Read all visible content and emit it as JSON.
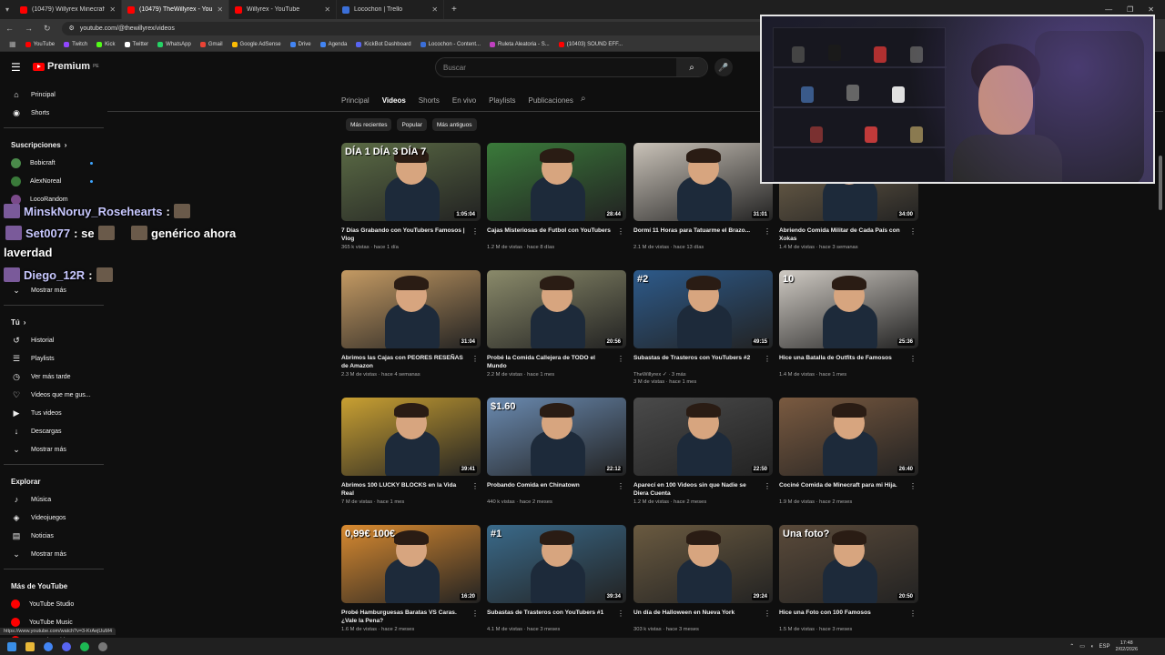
{
  "browser": {
    "tabs": [
      {
        "title": "(10479) Willyrex Minecraft - Yo",
        "active": false,
        "type": "youtube"
      },
      {
        "title": "(10479) TheWillyrex - YouTube",
        "active": true,
        "type": "youtube"
      },
      {
        "title": "Willyrex - YouTube",
        "active": false,
        "type": "youtube"
      },
      {
        "title": "Locochon | Trello",
        "active": false,
        "type": "trello"
      }
    ],
    "url": "youtube.com/@thewillyrex/videos",
    "bookmarks": [
      "YouTube",
      "Twitch",
      "Kick",
      "Twitter",
      "WhatsApp",
      "Gmail",
      "Google AdSense",
      "Drive",
      "Agenda",
      "KickBot Dashboard",
      "Locochon - Content...",
      "Ruleta Aleatoria - S...",
      "(10403) SOUND EFF..."
    ]
  },
  "youtube": {
    "logo_text": "Premium",
    "logo_sup": "PE",
    "search_placeholder": "Buscar"
  },
  "sidebar": {
    "main": [
      {
        "label": "Principal",
        "icon": "home-icon"
      },
      {
        "label": "Shorts",
        "icon": "shorts-icon"
      }
    ],
    "subs_header": "Suscripciones",
    "subs": [
      {
        "label": "Bobicraft",
        "live": true
      },
      {
        "label": "AlexNoreal",
        "live": true
      },
      {
        "label": "LocoRandom",
        "live": false
      }
    ],
    "show_more_1": "Mostrar más",
    "you_header": "Tú",
    "you_items": [
      {
        "label": "Historial",
        "icon": "history-icon"
      },
      {
        "label": "Playlists",
        "icon": "playlist-icon"
      },
      {
        "label": "Ver más tarde",
        "icon": "clock-icon"
      },
      {
        "label": "Videos que me gus...",
        "icon": "like-icon"
      },
      {
        "label": "Tus videos",
        "icon": "video-icon"
      },
      {
        "label": "Descargas",
        "icon": "download-icon"
      }
    ],
    "show_more_2": "Mostrar más",
    "explore_header": "Explorar",
    "explore_items": [
      {
        "label": "Música",
        "icon": "music-icon"
      },
      {
        "label": "Videojuegos",
        "icon": "gamepad-icon"
      },
      {
        "label": "Noticias",
        "icon": "news-icon"
      }
    ],
    "show_more_3": "Mostrar más",
    "more_header": "Más de YouTube",
    "more_items": [
      {
        "label": "YouTube Studio"
      },
      {
        "label": "YouTube Music"
      },
      {
        "label": "YouTube Kids"
      }
    ]
  },
  "chat_overlay": [
    {
      "user": "MinskNoruy_Rosehearts",
      "msg": ":"
    },
    {
      "user": "Set0077",
      "msg": ": se"
    },
    {
      "user": "",
      "msg": "genérico ahora"
    },
    {
      "user": "",
      "msg": "laverdad"
    },
    {
      "user": "Diego_12R",
      "msg": ":"
    }
  ],
  "channel_tabs": [
    "Principal",
    "Videos",
    "Shorts",
    "En vivo",
    "Playlists",
    "Publicaciones"
  ],
  "active_tab": "Videos",
  "chips": [
    "Más recientes",
    "Popular",
    "Más antiguos"
  ],
  "videos": [
    {
      "title": "7 Días Grabando con YouTubers Famosos | Vlog",
      "meta": "365 k vistas · hace 1 día",
      "duration": "1:05:04",
      "overlay": "DÍA 1   DÍA 3   DÍA 7",
      "bg": "#5b6b45"
    },
    {
      "title": "Cajas Misteriosas de Futbol con YouTubers",
      "meta": "1.2 M de vistas · hace 8 días",
      "duration": "28:44",
      "overlay": "",
      "bg": "#3a7a3a"
    },
    {
      "title": "Dormí 11 Horas para Tatuarme el Brazo...",
      "meta": "2.1 M de vistas · hace 13 días",
      "duration": "31:01",
      "overlay": "",
      "bg": "#c9c2b8"
    },
    {
      "title": "Abriendo Comida Militar de Cada País con Xokas",
      "meta": "1.4 M de vistas · hace 3 semanas",
      "duration": "34:00",
      "overlay": "",
      "bg": "#7a6a50"
    },
    {
      "title": "Abrimos las Cajas con PEORES RESEÑAS de Amazon",
      "meta": "2.3 M de vistas · hace 4 semanas",
      "duration": "31:04",
      "overlay": "",
      "bg": "#c49a63"
    },
    {
      "title": "Probé la Comida Callejera de TODO el Mundo",
      "meta": "2.2 M de vistas · hace 1 mes",
      "duration": "20:56",
      "overlay": "",
      "bg": "#8a8a6a"
    },
    {
      "title": "Subastas de Trasteros con YouTubers #2",
      "meta": "TheWillyrex ✓ · 3 más\n3 M de vistas · hace 1 mes",
      "duration": "49:15",
      "overlay": "#2",
      "bg": "#2d5a8a"
    },
    {
      "title": "Hice una Batalla de Outfits de Famosos",
      "meta": "1.4 M de vistas · hace 1 mes",
      "duration": "25:36",
      "overlay": "10",
      "bg": "#cfcac3"
    },
    {
      "title": "Abrimos 100 LUCKY BLOCKS en la Vida Real",
      "meta": "7 M de vistas · hace 1 mes",
      "duration": "39:41",
      "overlay": "",
      "bg": "#c9a032"
    },
    {
      "title": "Probando Comida en Chinatown",
      "meta": "440 k vistas · hace 2 meses",
      "duration": "22:12",
      "overlay": "$1.60",
      "bg": "#6a8ab0"
    },
    {
      "title": "Aparecí en 100 Videos sin que Nadie se Diera Cuenta",
      "meta": "1.2 M de vistas · hace 2 meses",
      "duration": "22:50",
      "overlay": "",
      "bg": "#4a4a4a"
    },
    {
      "title": "Cociné Comida de Minecraft para mi Hija.",
      "meta": "1.9 M de vistas · hace 2 meses",
      "duration": "26:40",
      "overlay": "",
      "bg": "#7a5a40"
    },
    {
      "title": "Probé Hamburguesas Baratas VS Caras. ¿Vale la Pena?",
      "meta": "1.6 M de vistas · hace 2 meses",
      "duration": "16:20",
      "overlay": "0,99€    100€",
      "bg": "#d88a30"
    },
    {
      "title": "Subastas de Trasteros con YouTubers #1",
      "meta": "4.1 M de vistas · hace 3 meses",
      "duration": "39:34",
      "overlay": "#1",
      "bg": "#3a6a8a"
    },
    {
      "title": "Un día de Halloween en Nueva York",
      "meta": "303 k vistas · hace 3 meses",
      "duration": "29:24",
      "overlay": "",
      "bg": "#6a5a40"
    },
    {
      "title": "Hice una Foto con 100 Famosos",
      "meta": "1.5 M de vistas · hace 3 meses",
      "duration": "20:50",
      "overlay": "Una foto?",
      "bg": "#5a4a3a"
    }
  ],
  "status_url": "https://www.youtube.com/watch?v=3-KrAejUuM4",
  "taskbar": {
    "lang": "ESP",
    "time": "17:48",
    "date": "2/02/2026"
  }
}
